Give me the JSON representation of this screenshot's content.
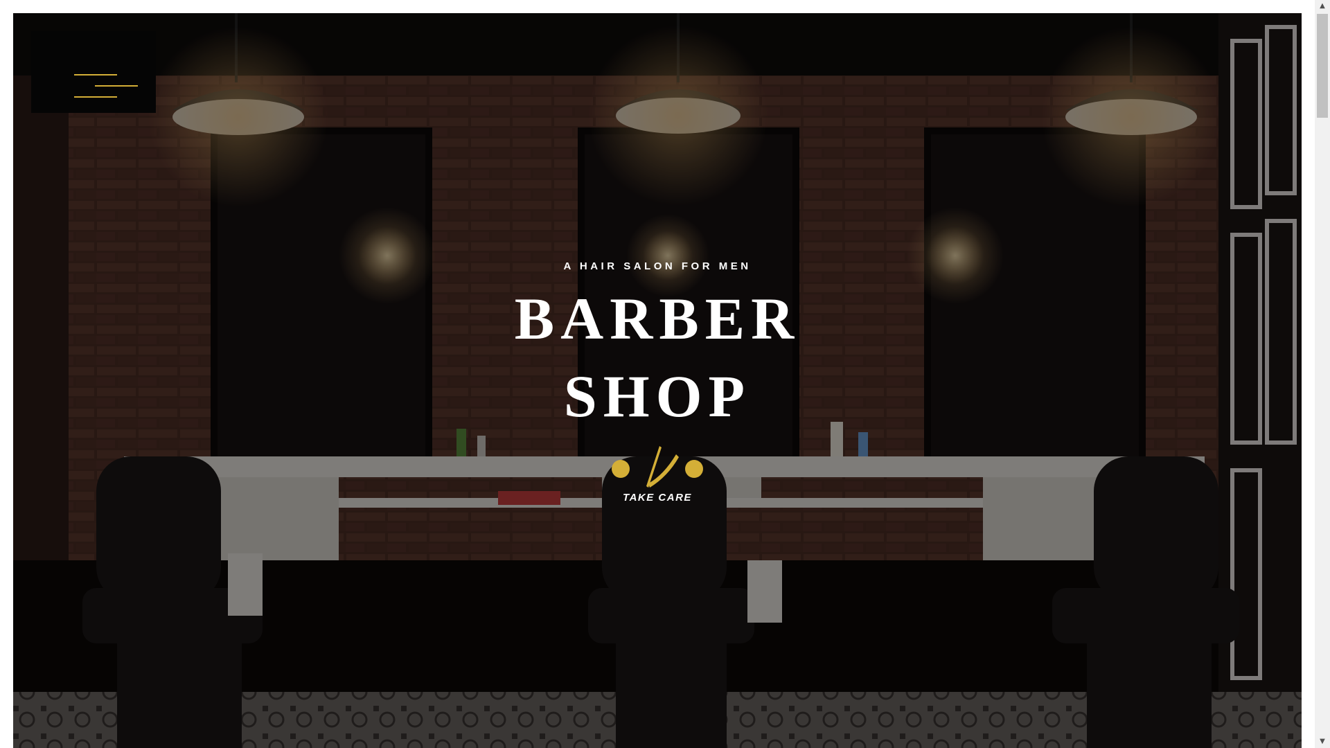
{
  "menu": {
    "icon": "hamburger-menu-icon"
  },
  "hero": {
    "subtitle": "A HAIR SALON FOR MEN",
    "title_line1": "BARBER",
    "title_line2": "SHOP",
    "divider_icon": "straight-razor-icon",
    "tagline": "TAKE CARE"
  },
  "colors": {
    "accent": "#d4af37",
    "text": "#ffffff",
    "overlay": "#000000"
  },
  "scrollbar": {
    "up_icon": "▲",
    "down_icon": "▼"
  }
}
